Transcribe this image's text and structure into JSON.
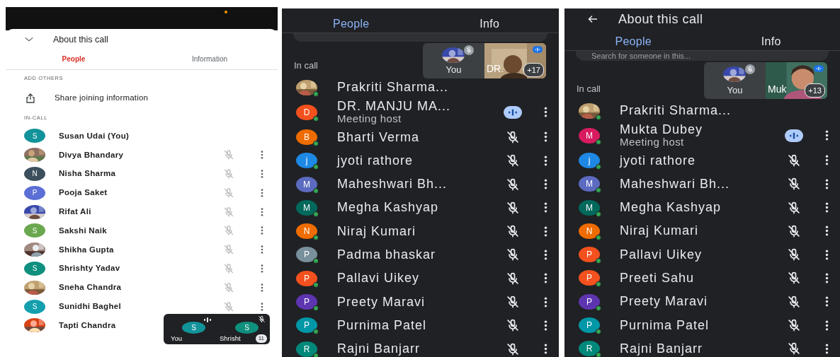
{
  "screens": [
    {
      "kind": "light",
      "title": "About this call",
      "tabs": [
        {
          "label": "People",
          "selected": true
        },
        {
          "label": "Information",
          "selected": false
        }
      ],
      "add_others": {
        "heading": "ADD OTHERS",
        "action": "Share joining information"
      },
      "in_call_heading": "IN-CALL",
      "participants": [
        {
          "name": "Susan Udai (You)",
          "kind": "letter",
          "initial": "S",
          "color": "#12939a",
          "muted": false,
          "speaking": false,
          "menu": false
        },
        {
          "name": "Divya Bhandary",
          "muted": true,
          "speaking": false,
          "menu": true
        },
        {
          "name": "Nisha Sharma",
          "kind": "letter",
          "initial": "N",
          "color": "#3c4f5c",
          "muted": true,
          "speaking": false,
          "menu": true
        },
        {
          "name": "Pooja Saket",
          "kind": "letter",
          "initial": "P",
          "color": "#5b6fd6",
          "muted": true,
          "speaking": false,
          "menu": true
        },
        {
          "name": "Rifat Ali",
          "muted": true,
          "speaking": false,
          "menu": true
        },
        {
          "name": "Sakshi Naik",
          "kind": "letter",
          "initial": "S",
          "color": "#6aa84f",
          "muted": true,
          "speaking": false,
          "menu": true
        },
        {
          "name": "Shikha Gupta",
          "muted": true,
          "speaking": false,
          "menu": true
        },
        {
          "name": "Shrishty Yadav",
          "kind": "letter",
          "initial": "S",
          "color": "#0f8f7e",
          "muted": true,
          "speaking": false,
          "menu": true
        },
        {
          "name": "Sneha Chandra",
          "muted": true,
          "speaking": false,
          "menu": true
        },
        {
          "name": "Sunidhi Baghel",
          "kind": "letter",
          "initial": "S",
          "color": "#139fad",
          "muted": true,
          "speaking": false,
          "menu": true
        },
        {
          "name": "Tapti Chandra",
          "muted": false,
          "speaking": false,
          "menu": false
        }
      ],
      "mini_call": {
        "tiles": [
          {
            "label": "You",
            "initial": "S",
            "color": "#12939a",
            "speaking": true,
            "muted": false
          },
          {
            "label": "Shrisht",
            "initial": "S",
            "color": "#0f8f7e",
            "speaking": false,
            "muted": true
          }
        ],
        "count": "11"
      }
    },
    {
      "kind": "dark",
      "tabs": [
        {
          "label": "People",
          "selected": true
        },
        {
          "label": "Info",
          "selected": false
        }
      ],
      "in_call_heading": "In call",
      "tiles": [
        {
          "kind": "self",
          "label": "You",
          "muted": true,
          "speaking": false
        },
        {
          "kind": "video",
          "label": "DR.",
          "badge": "+17",
          "muted": false,
          "speaking": true
        }
      ],
      "participants": [
        {
          "name": "Prakriti Sharma...",
          "muted": false,
          "speaking": false,
          "menu": false
        },
        {
          "name": "DR. MANJU MA...",
          "subtitle": "Meeting host",
          "kind": "letter",
          "initial": "D",
          "color": "#f4511e",
          "muted": false,
          "speaking": true,
          "menu": true
        },
        {
          "name": "Bharti Verma",
          "kind": "letter",
          "initial": "B",
          "color": "#ef6c00",
          "muted": true,
          "speaking": false,
          "menu": true
        },
        {
          "name": "jyoti rathore",
          "kind": "letter",
          "initial": "j",
          "color": "#1e88e5",
          "muted": true,
          "speaking": false,
          "menu": true
        },
        {
          "name": "Maheshwari Bh...",
          "kind": "letter",
          "initial": "M",
          "color": "#5c6bc0",
          "muted": true,
          "speaking": false,
          "menu": true
        },
        {
          "name": "Megha Kashyap",
          "kind": "letter",
          "initial": "M",
          "color": "#00695c",
          "muted": true,
          "speaking": false,
          "menu": true
        },
        {
          "name": "Niraj Kumari",
          "kind": "letter",
          "initial": "N",
          "color": "#ef6c00",
          "muted": true,
          "speaking": false,
          "menu": true
        },
        {
          "name": "Padma bhaskar",
          "kind": "letter",
          "initial": "P",
          "color": "#78909c",
          "muted": true,
          "speaking": false,
          "menu": true
        },
        {
          "name": "Pallavi Uikey",
          "kind": "letter",
          "initial": "P",
          "color": "#f4511e",
          "muted": true,
          "speaking": false,
          "menu": true
        },
        {
          "name": "Preety Maravi",
          "kind": "letter",
          "initial": "P",
          "color": "#5e35b1",
          "muted": true,
          "speaking": false,
          "menu": true
        },
        {
          "name": "Purnima Patel",
          "kind": "letter",
          "initial": "P",
          "color": "#0097a7",
          "muted": true,
          "speaking": false,
          "menu": true
        },
        {
          "name": "Rajni Banjarr",
          "kind": "letter",
          "initial": "R",
          "color": "#00897b",
          "muted": true,
          "speaking": false,
          "menu": true
        }
      ]
    },
    {
      "kind": "dark",
      "title": "About this call",
      "tabs": [
        {
          "label": "People",
          "selected": true
        },
        {
          "label": "Info",
          "selected": false
        }
      ],
      "search": {
        "placeholder": "Search for someone in this..."
      },
      "in_call_heading": "In call",
      "tiles": [
        {
          "kind": "self",
          "label": "You",
          "muted": true,
          "speaking": false
        },
        {
          "kind": "video",
          "label": "Muk",
          "badge": "+13",
          "muted": false,
          "speaking": true
        }
      ],
      "participants": [
        {
          "name": "Prakriti Sharma...",
          "muted": false,
          "speaking": false,
          "menu": false
        },
        {
          "name": "Mukta Dubey",
          "subtitle": "Meeting host",
          "kind": "letter",
          "initial": "M",
          "color": "#d81b60",
          "muted": false,
          "speaking": true,
          "menu": true
        },
        {
          "name": "jyoti rathore",
          "kind": "letter",
          "initial": "j",
          "color": "#1e88e5",
          "muted": true,
          "speaking": false,
          "menu": true
        },
        {
          "name": "Maheshwari Bh...",
          "kind": "letter",
          "initial": "M",
          "color": "#5c6bc0",
          "muted": true,
          "speaking": false,
          "menu": true
        },
        {
          "name": "Megha Kashyap",
          "kind": "letter",
          "initial": "M",
          "color": "#00695c",
          "muted": true,
          "speaking": false,
          "menu": true
        },
        {
          "name": "Niraj Kumari",
          "kind": "letter",
          "initial": "N",
          "color": "#ef6c00",
          "muted": true,
          "speaking": false,
          "menu": true
        },
        {
          "name": "Pallavi Uikey",
          "kind": "letter",
          "initial": "P",
          "color": "#f4511e",
          "muted": true,
          "speaking": false,
          "menu": true
        },
        {
          "name": "Preeti Sahu",
          "kind": "letter",
          "initial": "P",
          "color": "#f4511e",
          "muted": true,
          "speaking": false,
          "menu": true
        },
        {
          "name": "Preety Maravi",
          "kind": "letter",
          "initial": "P",
          "color": "#5e35b1",
          "muted": true,
          "speaking": false,
          "menu": true
        },
        {
          "name": "Purnima Patel",
          "kind": "letter",
          "initial": "P",
          "color": "#0097a7",
          "muted": true,
          "speaking": false,
          "menu": true
        },
        {
          "name": "Rajni Banjarr",
          "kind": "letter",
          "initial": "R",
          "color": "#00897b",
          "muted": true,
          "speaking": false,
          "menu": true
        }
      ]
    }
  ]
}
